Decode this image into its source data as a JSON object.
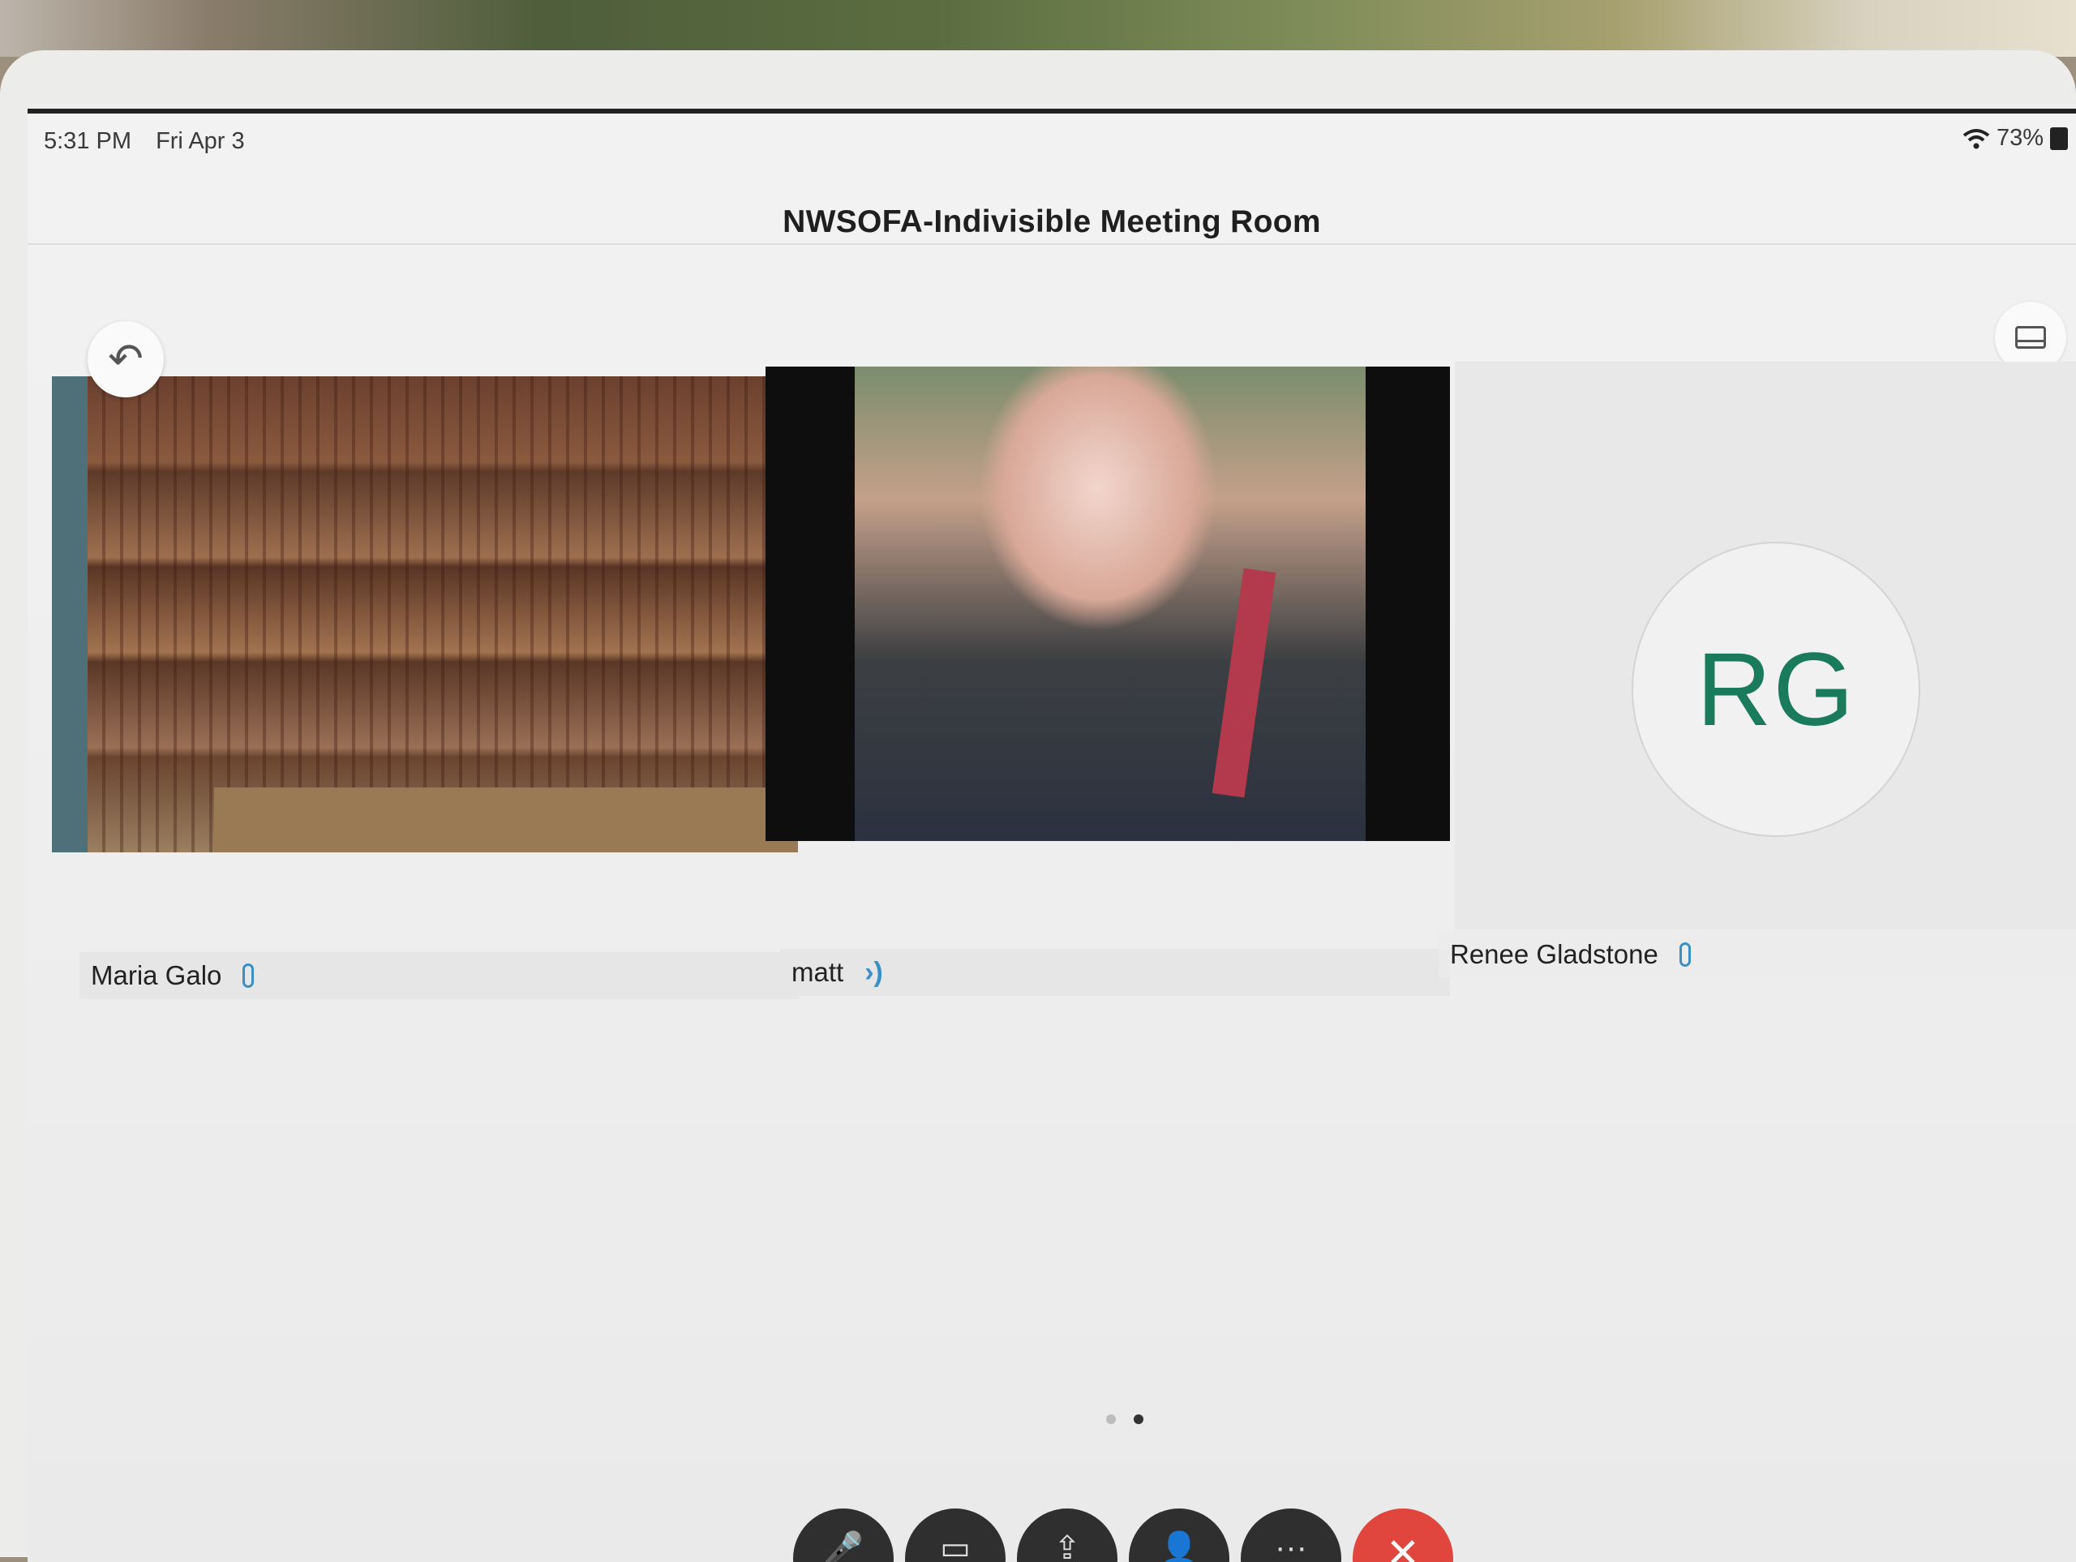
{
  "status_bar": {
    "time": "5:31 PM",
    "date": "Fri Apr 3",
    "battery": "73%"
  },
  "meeting": {
    "title": "NWSOFA-Indivisible Meeting Room"
  },
  "participants": [
    {
      "name": "Maria Galo",
      "audio": "mic-icon"
    },
    {
      "name": "matt",
      "audio": "speaker-active-icon"
    },
    {
      "name": "Renee Gladstone",
      "initials": "RG",
      "audio": "mic-icon"
    }
  ],
  "icons": {
    "back": "↶",
    "speaker_glyph": "›)",
    "more": "···",
    "end": "✕",
    "mute": "🎤",
    "video": "▭",
    "share": "⇪",
    "participants": "👤"
  },
  "pager": {
    "pages": 2,
    "current": 2
  },
  "colors": {
    "avatar_text": "#1a7a5c",
    "end_call": "#e0463e",
    "audio_accent": "#3a8fc6"
  }
}
